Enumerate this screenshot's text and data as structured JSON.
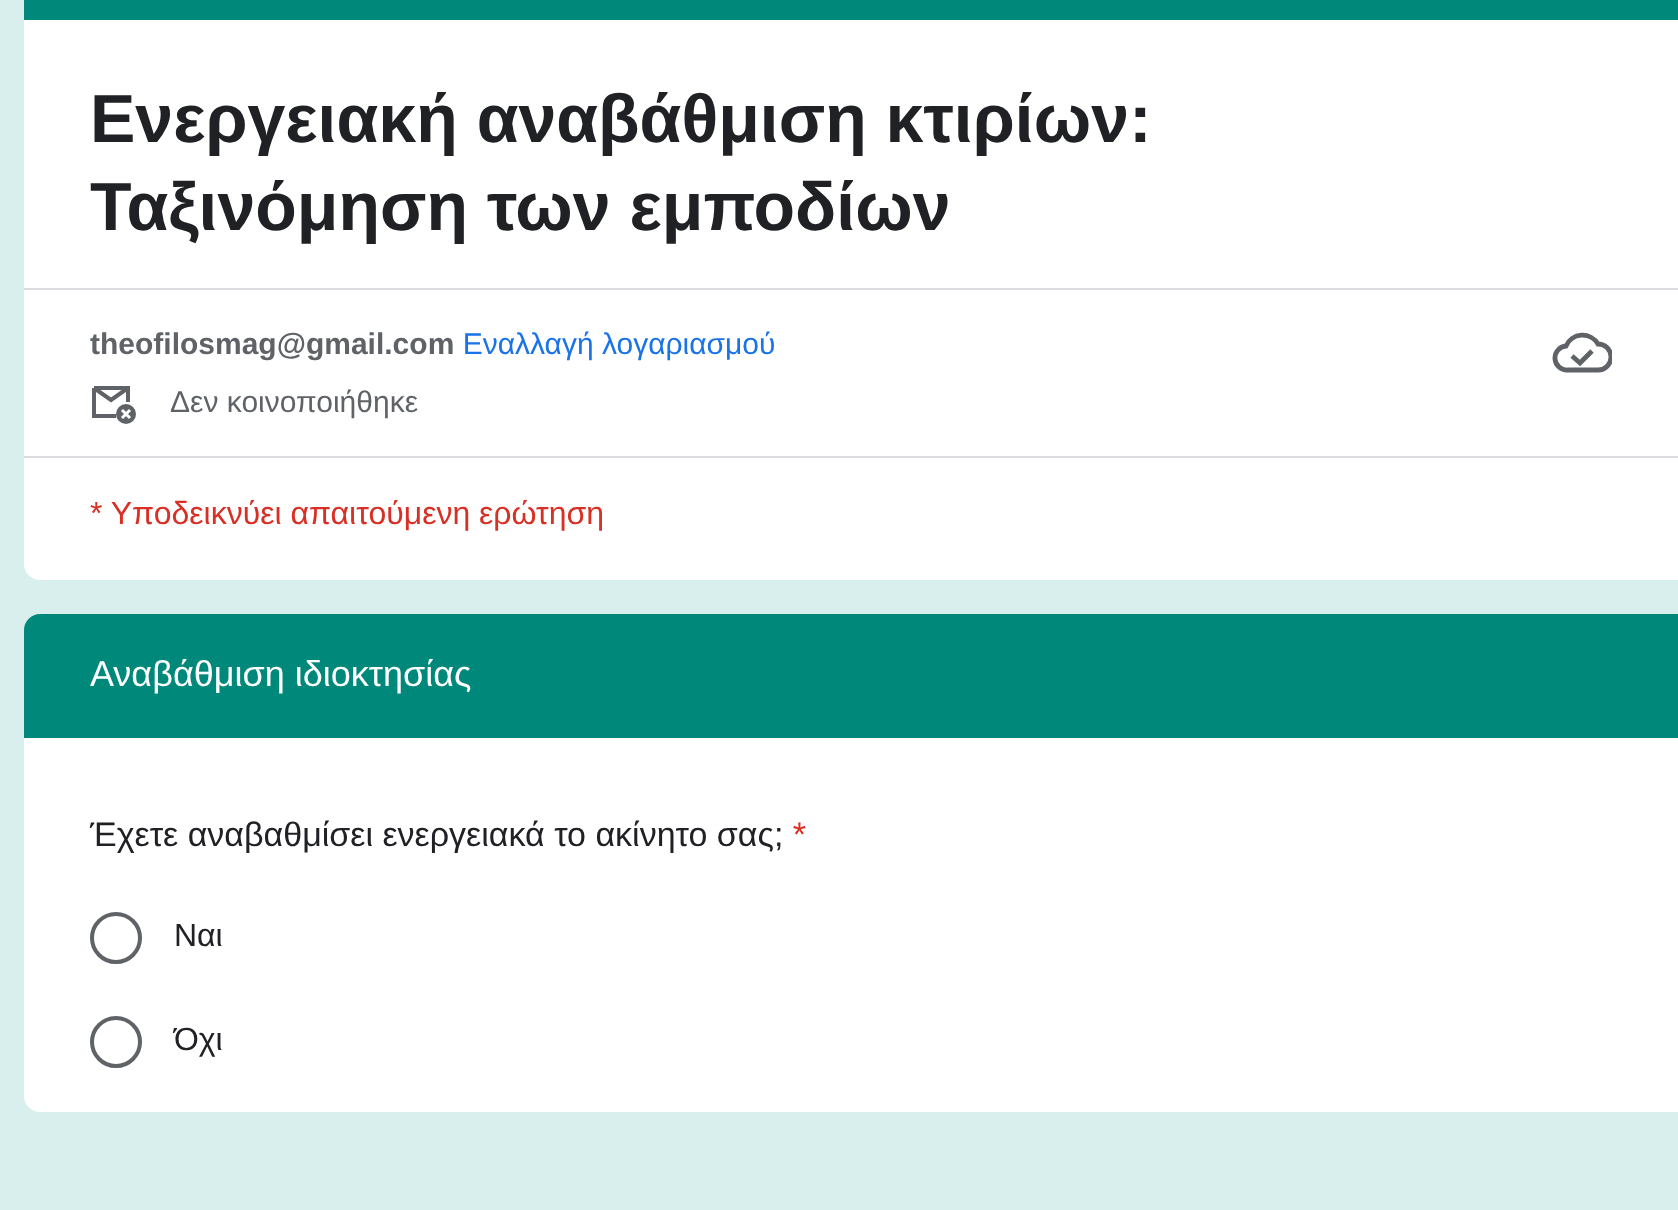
{
  "form": {
    "title": "Ενεργειακή αναβάθμιση κτιρίων: Ταξινόμηση των εμποδίων",
    "account": {
      "email": "theofilosmag@gmail.com",
      "switch_link": "Εναλλαγή λογαριασμού"
    },
    "sharing_note": "Δεν κοινοποιήθηκε",
    "required_note": "* Υποδεικνύει απαιτούμενη ερώτηση"
  },
  "section": {
    "title": "Αναβάθμιση ιδιοκτησίας",
    "question": {
      "text": "Έχετε αναβαθμίσει ενεργειακά το ακίνητο σας;",
      "required_mark": "*",
      "options": [
        {
          "label": "Ναι",
          "selected": false
        },
        {
          "label": "Όχι",
          "selected": false
        }
      ]
    }
  }
}
